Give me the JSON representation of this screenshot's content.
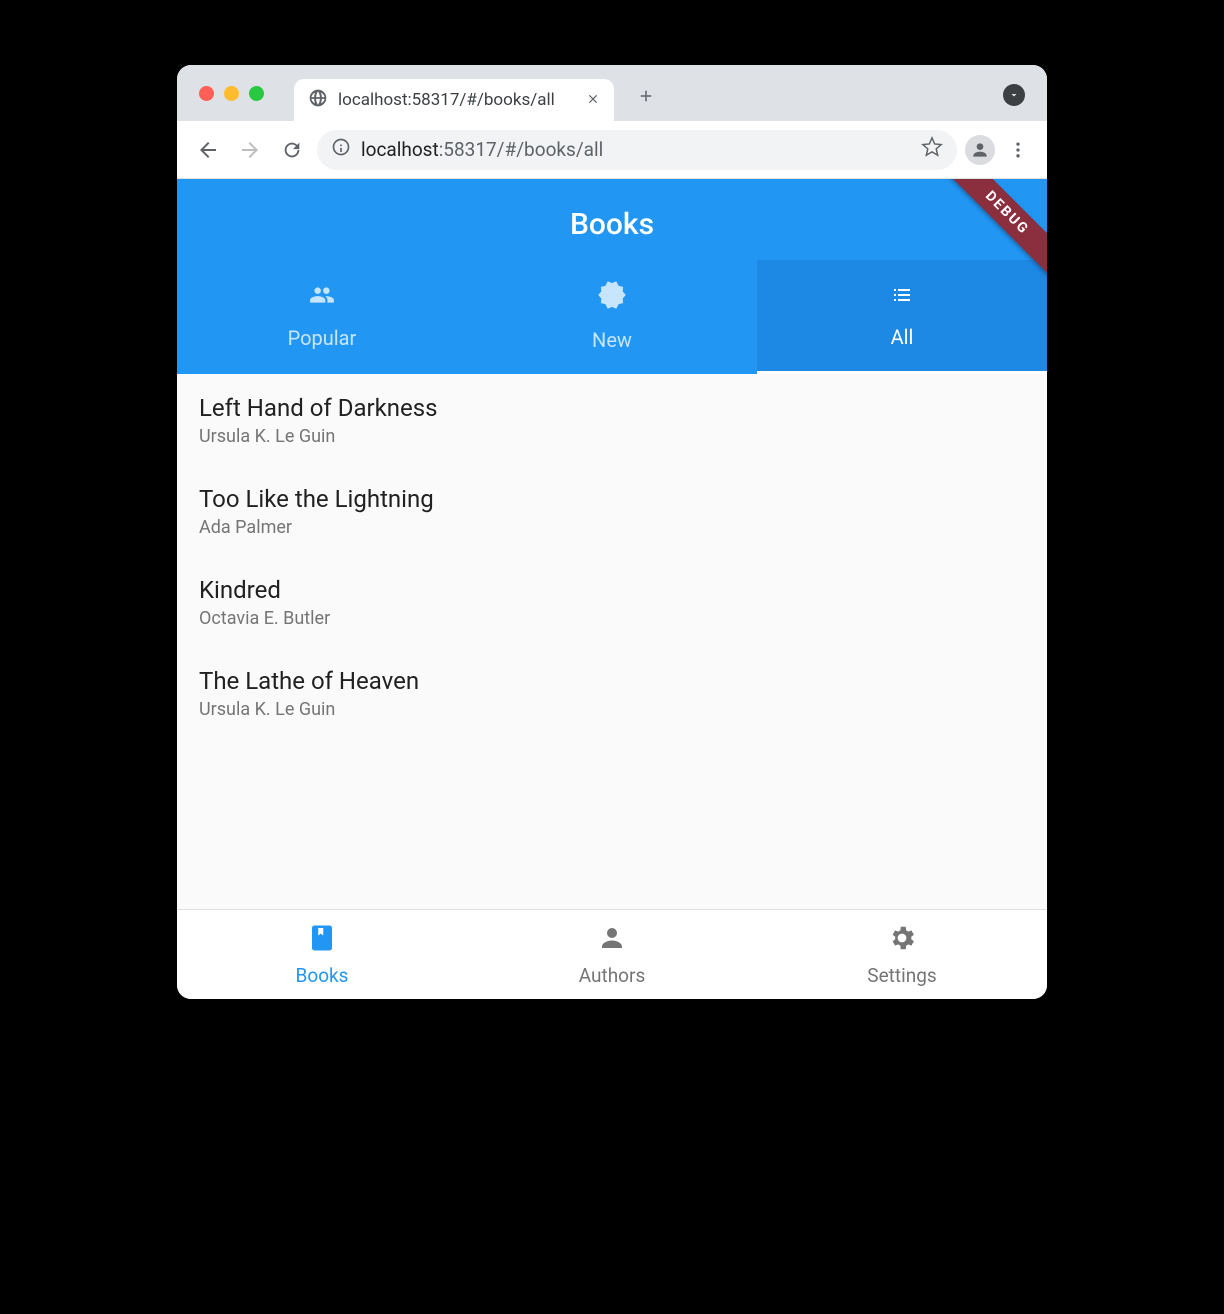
{
  "browser": {
    "tab_title": "localhost:58317/#/books/all",
    "url_host": "localhost",
    "url_path": ":58317/#/books/all"
  },
  "app": {
    "debug_label": "DEBUG",
    "title": "Books",
    "tabs": [
      {
        "label": "Popular",
        "active": false,
        "icon": "people"
      },
      {
        "label": "New",
        "active": false,
        "icon": "new-releases"
      },
      {
        "label": "All",
        "active": true,
        "icon": "list"
      }
    ],
    "books": [
      {
        "title": "Left Hand of Darkness",
        "author": "Ursula K. Le Guin"
      },
      {
        "title": "Too Like the Lightning",
        "author": "Ada Palmer"
      },
      {
        "title": "Kindred",
        "author": "Octavia E. Butler"
      },
      {
        "title": "The Lathe of Heaven",
        "author": "Ursula K. Le Guin"
      }
    ],
    "bottom_nav": [
      {
        "label": "Books",
        "active": true,
        "icon": "book"
      },
      {
        "label": "Authors",
        "active": false,
        "icon": "person"
      },
      {
        "label": "Settings",
        "active": false,
        "icon": "gear"
      }
    ]
  }
}
